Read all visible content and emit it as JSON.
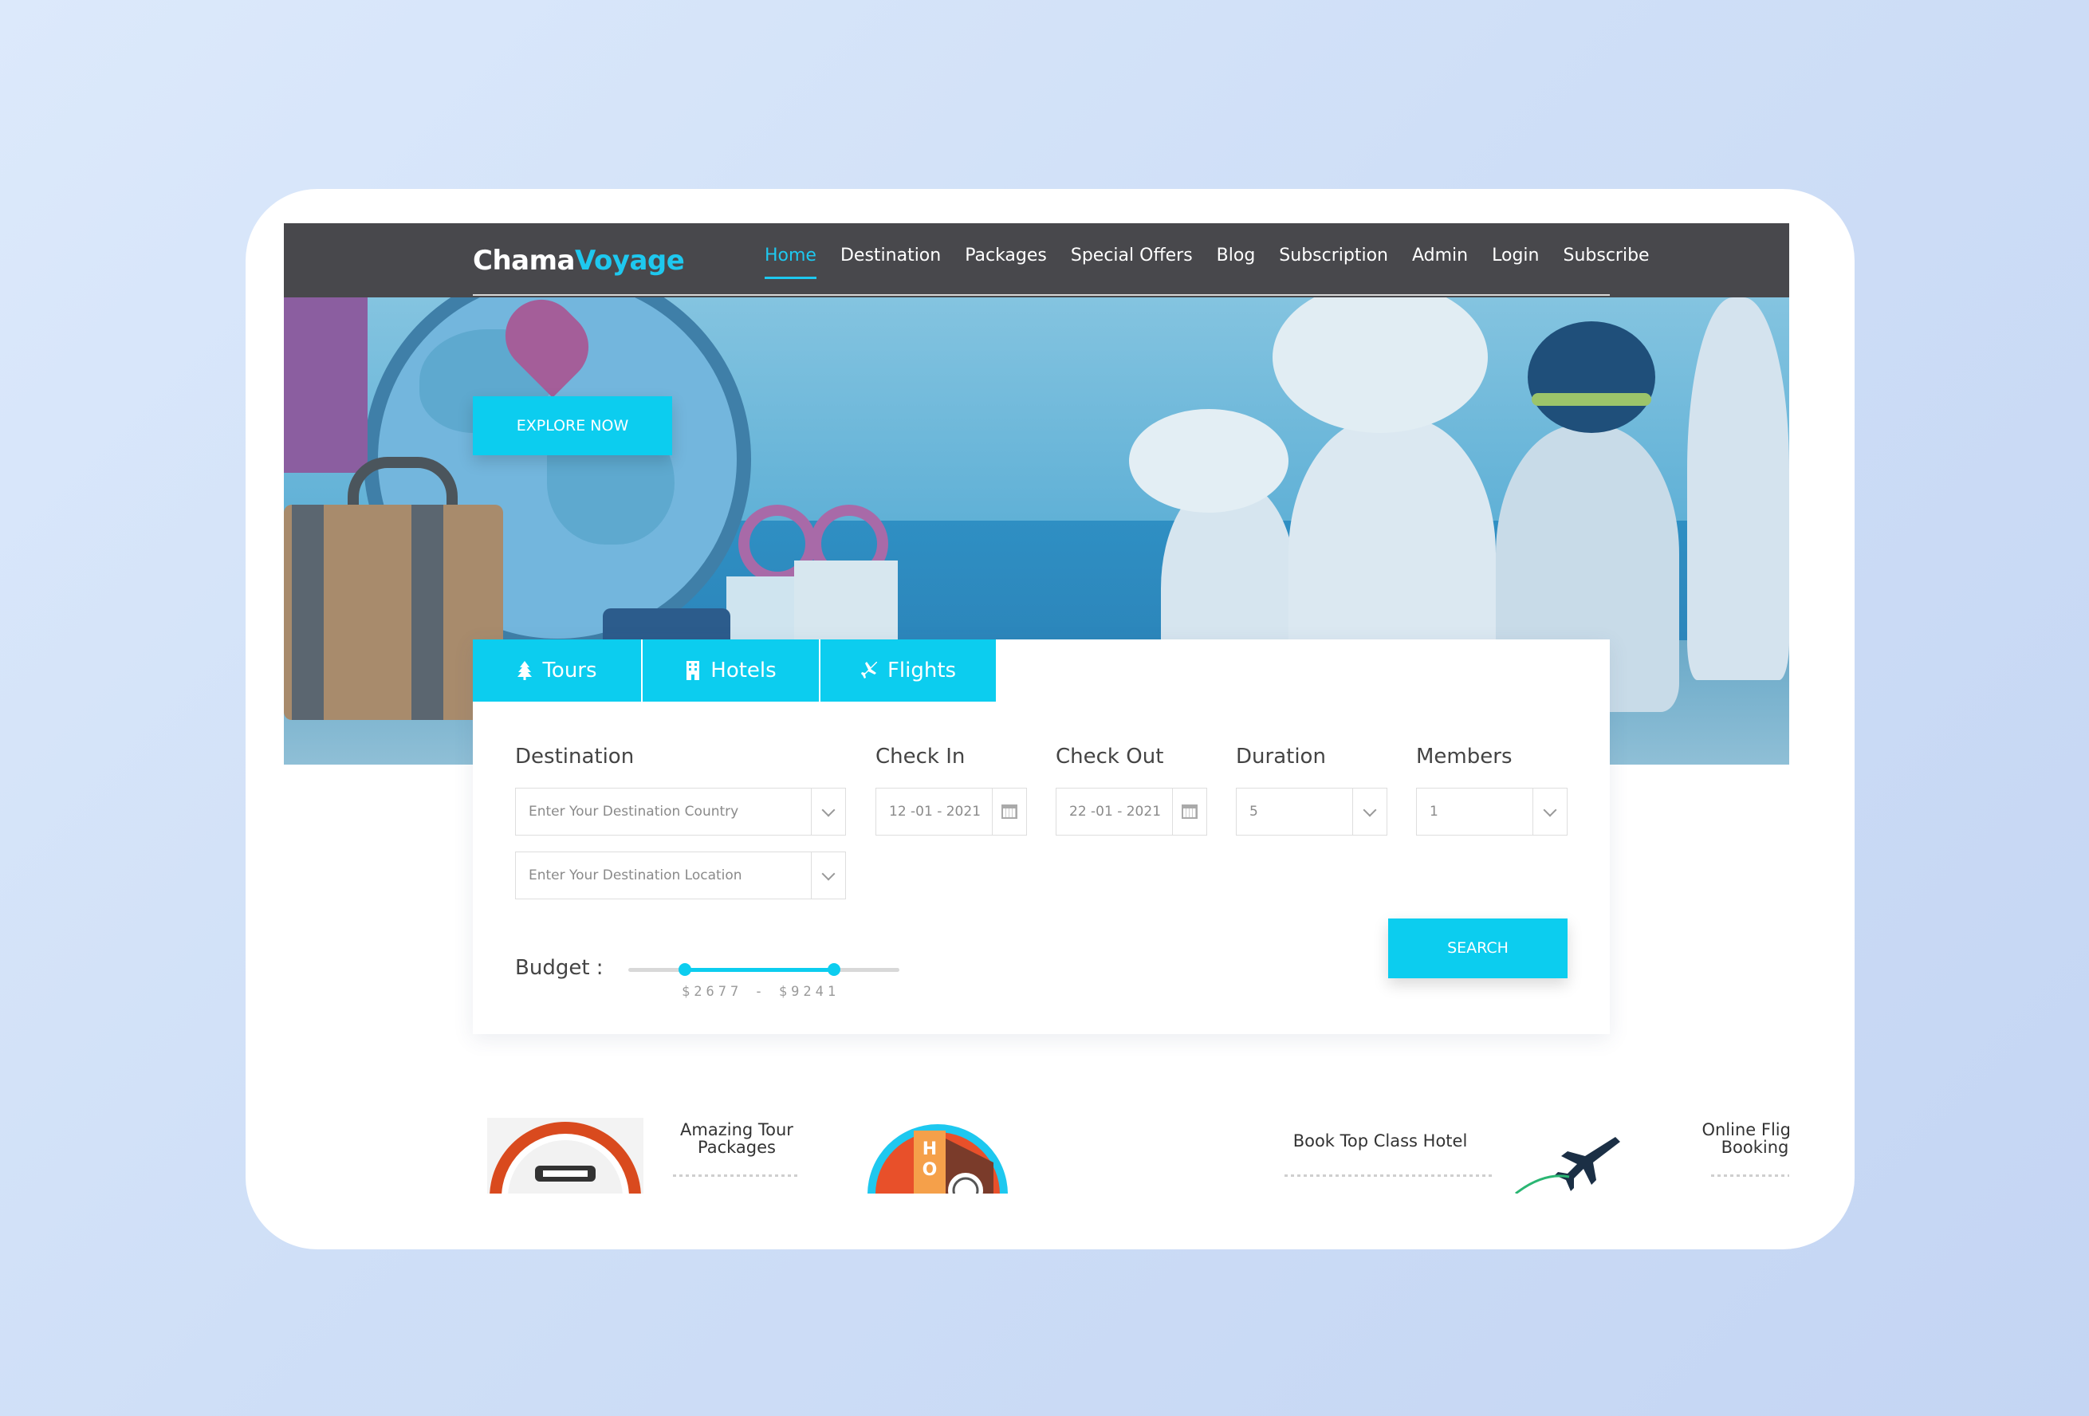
{
  "brand": {
    "part1": "Chama",
    "part2": "Voyage",
    "accent_color": "#1ec8ef"
  },
  "nav": {
    "items": [
      {
        "label": "Home",
        "active": true
      },
      {
        "label": "Destination"
      },
      {
        "label": "Packages"
      },
      {
        "label": "Special Offers"
      },
      {
        "label": "Blog"
      },
      {
        "label": "Subscription"
      },
      {
        "label": "Admin"
      },
      {
        "label": "Login"
      },
      {
        "label": "Subscribe"
      }
    ]
  },
  "hero": {
    "explore_label": "EXPLORE NOW"
  },
  "tabs": [
    {
      "label": "Tours",
      "icon": "tree-icon"
    },
    {
      "label": "Hotels",
      "icon": "building-icon"
    },
    {
      "label": "Flights",
      "icon": "plane-icon"
    }
  ],
  "search": {
    "destination": {
      "label": "Destination",
      "country_placeholder": "Enter Your Destination Country",
      "location_placeholder": "Enter Your Destination Location"
    },
    "check_in": {
      "label": "Check In",
      "value": "12 -01 - 2021"
    },
    "check_out": {
      "label": "Check Out",
      "value": "22 -01 - 2021"
    },
    "duration": {
      "label": "Duration",
      "value": "5"
    },
    "members": {
      "label": "Members",
      "value": "1"
    },
    "budget": {
      "label": "Budget :",
      "range_text": "$2677 - $9241",
      "min_fraction": 0.21,
      "max_fraction": 0.76
    },
    "search_label": "SEARCH"
  },
  "features": [
    {
      "title_line1": "Amazing Tour",
      "title_line2": "Packages"
    },
    {
      "title_line1": "Book Top Class Hotel",
      "title_line2": ""
    },
    {
      "title_line1": "Online Flight",
      "title_line2": "Booking"
    }
  ],
  "colors": {
    "primary": "#0ccdef",
    "header_bg": "#48484c"
  }
}
